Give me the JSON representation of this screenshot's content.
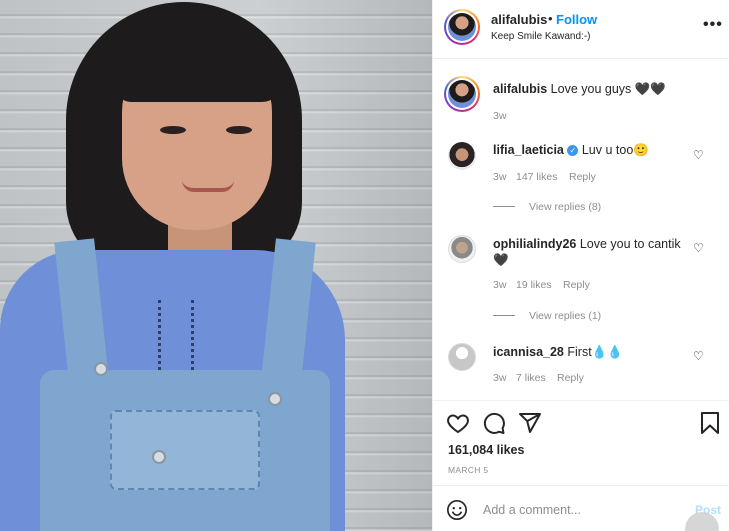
{
  "post": {
    "header": {
      "username": "alifalubis",
      "separator": "•",
      "follow_label": "Follow",
      "location": "Keep Smile Kawand:-)",
      "more_icon": "more-options-icon"
    },
    "caption": {
      "username": "alifalubis",
      "text": "Love you guys 🖤🖤",
      "time": "3w"
    },
    "comments": [
      {
        "username": "lifia_laeticia",
        "verified": true,
        "text": "Luv u too🙂",
        "time": "3w",
        "likes": "147 likes",
        "reply_label": "Reply",
        "view_replies": "View replies (8)"
      },
      {
        "username": "ophilialindy26",
        "verified": false,
        "text": "Love you to cantik 🖤",
        "time": "3w",
        "likes": "19 likes",
        "reply_label": "Reply",
        "view_replies": "View replies (1)"
      },
      {
        "username": "icannisa_28",
        "verified": false,
        "text": "First💧💧",
        "time": "3w",
        "likes": "7 likes",
        "reply_label": "Reply"
      }
    ],
    "actions": {
      "likes": "161,084 likes",
      "date": "MARCH 5",
      "icons": [
        "heart-icon",
        "comment-icon",
        "share-icon",
        "bookmark-icon"
      ]
    },
    "add_comment": {
      "placeholder": "Add a comment...",
      "post_label": "Post",
      "emoji_icon": "emoji-icon"
    },
    "colors": {
      "link_blue": "#0095f6",
      "muted": "#8e8e8e",
      "text": "#262626",
      "verified": "#3897f0"
    }
  }
}
